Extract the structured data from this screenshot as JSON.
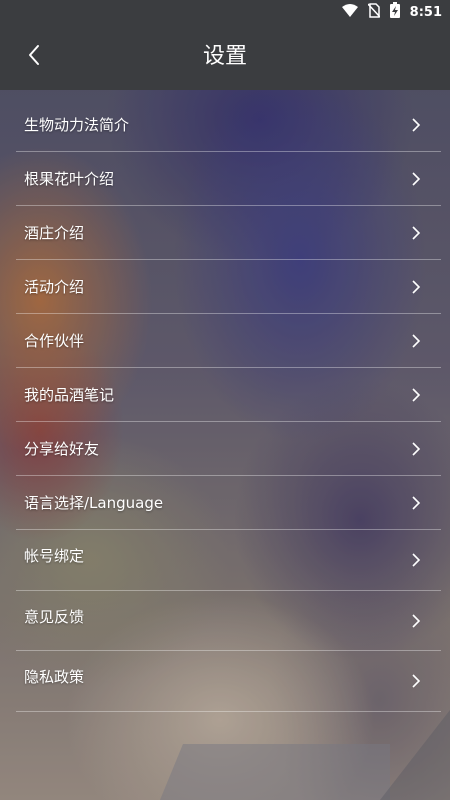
{
  "status_bar": {
    "time": "8:51",
    "icons": [
      "wifi-icon",
      "no-sim-icon",
      "battery-charging-icon"
    ]
  },
  "header": {
    "title": "设置",
    "back_icon": "chevron-left-icon"
  },
  "menu": {
    "items": [
      {
        "label": "生物动力法简介"
      },
      {
        "label": "根果花叶介绍"
      },
      {
        "label": "酒庄介绍"
      },
      {
        "label": "活动介绍"
      },
      {
        "label": "合作伙伴"
      },
      {
        "label": "我的品酒笔记"
      },
      {
        "label": "分享给好友"
      },
      {
        "label": "语言选择/Language"
      },
      {
        "label": "帐号绑定"
      },
      {
        "label": "意见反馈"
      },
      {
        "label": "隐私政策"
      }
    ]
  },
  "colors": {
    "header_bg": "#3b3d40",
    "text": "#ffffff",
    "divider": "rgba(255,255,255,0.35)"
  }
}
